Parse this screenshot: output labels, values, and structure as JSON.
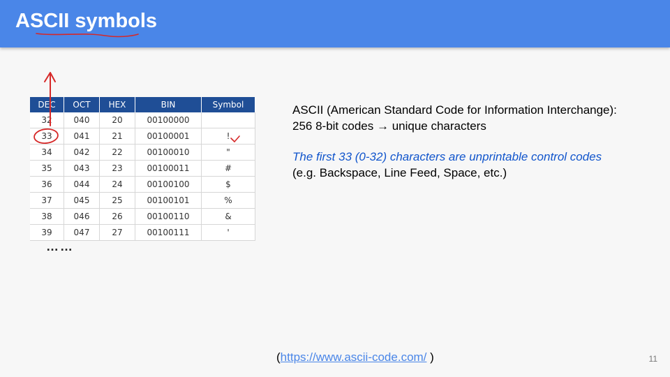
{
  "slide": {
    "title": "ASCII symbols",
    "page_number": "11"
  },
  "table": {
    "headers": [
      "DEC",
      "OCT",
      "HEX",
      "BIN",
      "Symbol"
    ],
    "rows": [
      [
        "32",
        "040",
        "20",
        "00100000",
        ""
      ],
      [
        "33",
        "041",
        "21",
        "00100001",
        "!"
      ],
      [
        "34",
        "042",
        "22",
        "00100010",
        "\""
      ],
      [
        "35",
        "043",
        "23",
        "00100011",
        "#"
      ],
      [
        "36",
        "044",
        "24",
        "00100100",
        "$"
      ],
      [
        "37",
        "045",
        "25",
        "00100101",
        "%"
      ],
      [
        "38",
        "046",
        "26",
        "00100110",
        "&"
      ],
      [
        "39",
        "047",
        "27",
        "00100111",
        "'"
      ]
    ]
  },
  "continuation": "……",
  "description": {
    "line1": "ASCII (American Standard Code for Information Interchange):",
    "line2": "256 8-bit codes → unique characters",
    "highlight": "The first 33 (0-32) characters are unprintable control codes",
    "example": "(e.g. Backspace, Line Feed, Space, etc.)"
  },
  "footer": {
    "open": "(",
    "link_text": "https://www.ascii-code.com/",
    "close": " )"
  },
  "colors": {
    "header_bar": "#4a86e8",
    "table_header": "#1f4e96",
    "annotation_ink": "#d62828",
    "highlight_text": "#1155cc"
  }
}
